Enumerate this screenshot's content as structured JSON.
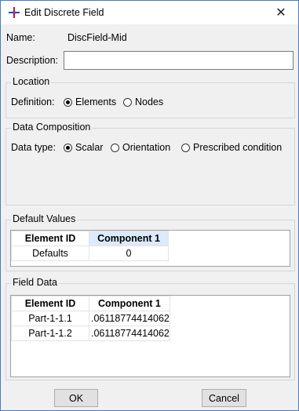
{
  "window": {
    "title": "Edit Discrete Field",
    "close_glyph": "✕",
    "app_icon": "abaqus-cross-icon"
  },
  "name": {
    "label": "Name:",
    "value": "DiscField-Mid"
  },
  "description": {
    "label": "Description:",
    "value": ""
  },
  "location": {
    "group_title": "Location",
    "definition_label": "Definition:",
    "options": [
      {
        "label": "Elements",
        "selected": true
      },
      {
        "label": "Nodes",
        "selected": false
      }
    ]
  },
  "data_composition": {
    "group_title": "Data Composition",
    "type_label": "Data type:",
    "options": [
      {
        "label": "Scalar",
        "selected": true
      },
      {
        "label": "Orientation",
        "selected": false
      },
      {
        "label": "Prescribed condition",
        "selected": false
      }
    ]
  },
  "default_values": {
    "group_title": "Default Values",
    "columns": [
      "Element ID",
      "Component 1"
    ],
    "rows": [
      [
        "Defaults",
        "0"
      ]
    ]
  },
  "field_data": {
    "group_title": "Field Data",
    "columns": [
      "Element ID",
      "Component 1"
    ],
    "rows": [
      [
        "Part-1-1.1",
        ".06118774414062"
      ],
      [
        "Part-1-1.2",
        ".06118774414062"
      ]
    ]
  },
  "buttons": {
    "ok": "OK",
    "cancel": "Cancel"
  }
}
